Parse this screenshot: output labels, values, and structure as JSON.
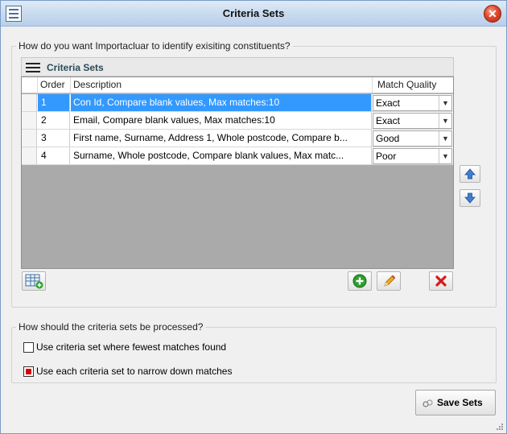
{
  "window": {
    "title": "Criteria Sets"
  },
  "identify_group": {
    "label": "How do you want Importacluar to identify exisiting constituents?"
  },
  "panel": {
    "title": "Criteria Sets"
  },
  "grid": {
    "columns": {
      "order": "Order",
      "description": "Description",
      "match_quality": "Match Quality"
    },
    "rows": [
      {
        "order": "1",
        "description": "Con Id, Compare blank values, Max matches:10",
        "match_quality": "Exact",
        "selected": true
      },
      {
        "order": "2",
        "description": "Email, Compare blank values, Max matches:10",
        "match_quality": "Exact",
        "selected": false
      },
      {
        "order": "3",
        "description": "First name, Surname, Address 1, Whole postcode, Compare b...",
        "match_quality": "Good",
        "selected": false
      },
      {
        "order": "4",
        "description": "Surname, Whole postcode, Compare blank values, Max matc...",
        "match_quality": "Poor",
        "selected": false
      }
    ]
  },
  "process_group": {
    "label": "How should the criteria sets be processed?",
    "options": [
      {
        "label": "Use criteria set where fewest matches found",
        "checked": false
      },
      {
        "label": "Use each criteria set to narrow down matches",
        "checked": true
      }
    ]
  },
  "buttons": {
    "save": "Save Sets"
  },
  "colors": {
    "selection": "#3399ff",
    "grid_background": "#aaaaaa",
    "delete": "#d21a1a",
    "add": "#2e9e2e",
    "arrow": "#3f7fd0"
  },
  "icons": [
    "app-grid-icon",
    "close-icon",
    "menu-icon",
    "move-up-icon",
    "move-down-icon",
    "add-table-icon",
    "add-icon",
    "edit-icon",
    "delete-icon",
    "save-icon",
    "chevron-down-icon",
    "resize-grip-icon"
  ]
}
